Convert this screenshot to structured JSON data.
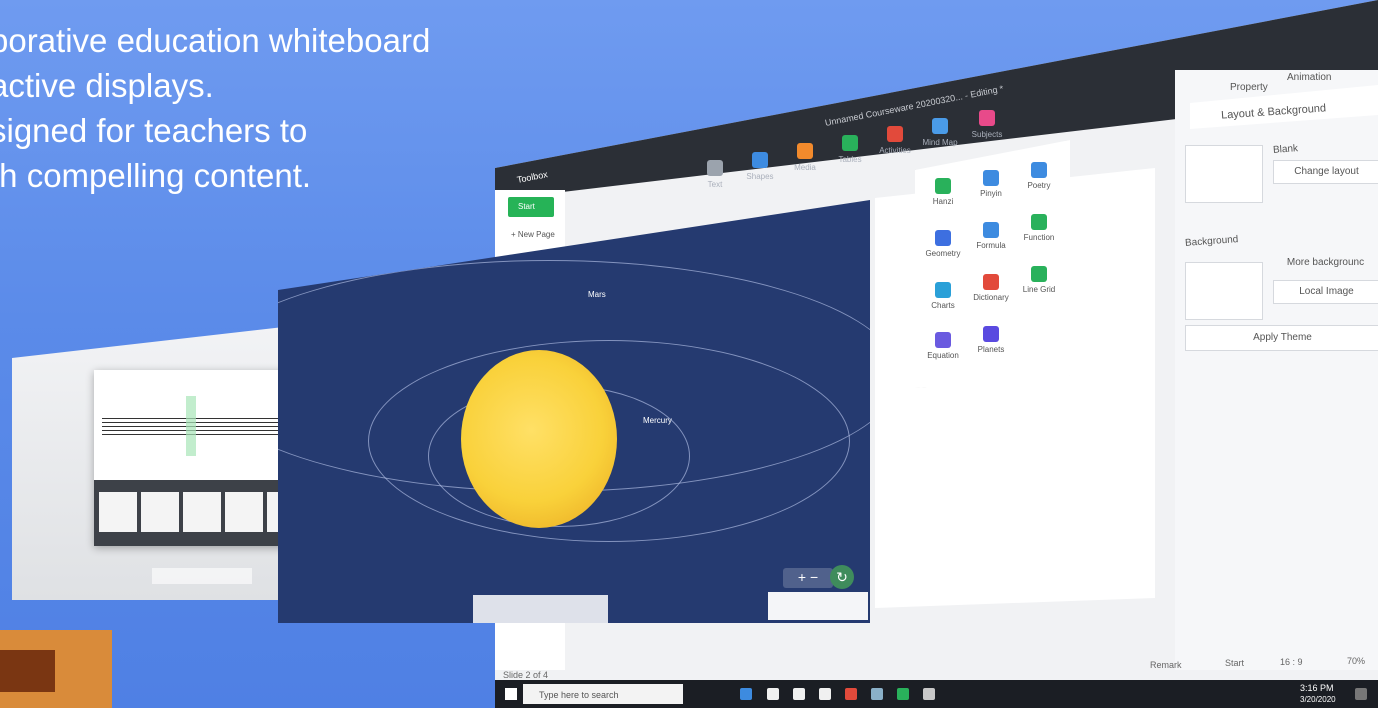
{
  "headline": {
    "line1": "borative education whiteboard",
    "line2": "active displays.",
    "line3": "signed for teachers to",
    "line4": "th compelling content."
  },
  "window": {
    "title": "Unnamed Courseware 20200320... - Editing *",
    "app_tab": "Toolbox",
    "start_label": "Start",
    "new_page": "+ New Page"
  },
  "toolbar": [
    {
      "label": "Text",
      "color": "#9ba3ad"
    },
    {
      "label": "Shapes",
      "color": "#3d8be0"
    },
    {
      "label": "Media",
      "color": "#f28a2c"
    },
    {
      "label": "Tables",
      "color": "#29b15b"
    },
    {
      "label": "Activities",
      "color": "#e24a3b"
    },
    {
      "label": "Mind Map",
      "color": "#4a9be8"
    },
    {
      "label": "Subjects",
      "color": "#e84a8a"
    }
  ],
  "subjects_menu": [
    {
      "label": "Hanzi",
      "color": "#29b15b"
    },
    {
      "label": "Pinyin",
      "color": "#3d8be0"
    },
    {
      "label": "Poetry",
      "color": "#3d8be0"
    },
    {
      "label": "Geometry",
      "color": "#3d6fe0"
    },
    {
      "label": "Formula",
      "color": "#3d8be0"
    },
    {
      "label": "Function",
      "color": "#29b15b"
    },
    {
      "label": "Charts",
      "color": "#2aa0d8"
    },
    {
      "label": "Dictionary",
      "color": "#e24a3b"
    },
    {
      "label": "Line Grid",
      "color": "#29b15b"
    },
    {
      "label": "Equation",
      "color": "#6a5ae0"
    },
    {
      "label": "Planets",
      "color": "#5a4ae0"
    }
  ],
  "right_panel": {
    "tab_property": "Property",
    "tab_animation": "Animation",
    "section_title": "Layout & Background",
    "blank_label": "Blank",
    "change_layout": "Change layout",
    "background_label": "Background",
    "more_backgrounds": "More backgrounc",
    "local_image": "Local Image",
    "apply_theme": "Apply Theme"
  },
  "slide": {
    "planet_mars": "Mars",
    "planet_mercury": "Mercury"
  },
  "status_bar": {
    "slide_count": "Slide 2 of 4",
    "remark": "Remark",
    "start": "Start",
    "ratio": "16 : 9",
    "zoom": "70%"
  },
  "taskbar": {
    "search_placeholder": "Type here to search",
    "time": "3:16 PM",
    "date": "3/20/2020"
  }
}
